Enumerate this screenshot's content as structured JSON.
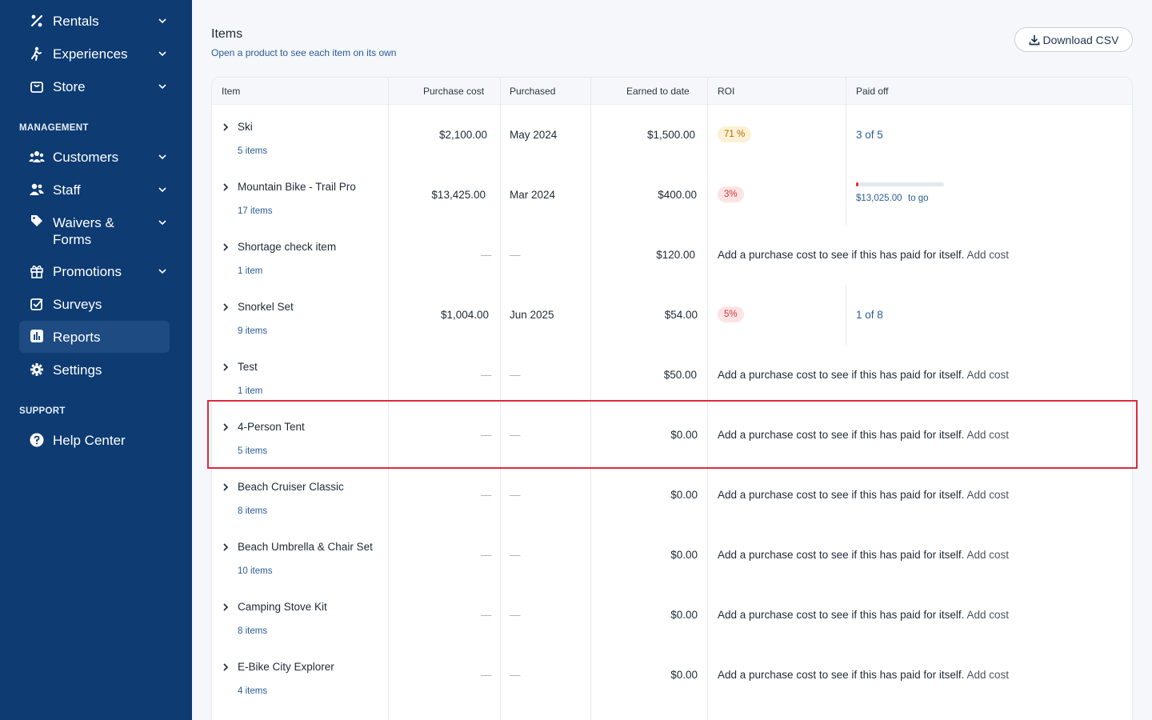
{
  "sidebar": {
    "items": [
      {
        "label": "Rentals",
        "icon": "rentals-icon"
      },
      {
        "label": "Experiences",
        "icon": "experiences-icon"
      },
      {
        "label": "Store",
        "icon": "store-icon"
      },
      {
        "label": "Customers",
        "icon": "customers-icon"
      },
      {
        "label": "Staff",
        "icon": "staff-icon"
      },
      {
        "label": "Waivers &",
        "label2": "Forms",
        "icon": "tag-icon"
      },
      {
        "label": "Promotions",
        "icon": "gift-icon"
      },
      {
        "label": "Surveys",
        "icon": "surveys-icon"
      },
      {
        "label": "Reports",
        "icon": "reports-icon"
      },
      {
        "label": "Settings",
        "icon": "gear-icon"
      },
      {
        "label": "Help Center",
        "icon": "help-icon"
      }
    ],
    "sections": {
      "management": "MANAGEMENT",
      "support": "SUPPORT"
    },
    "active": "Reports"
  },
  "items_section": {
    "title": "Items",
    "subtitle": "Open a product to see each item on its own",
    "download_label": "Download CSV"
  },
  "table": {
    "headers": {
      "item": "Item",
      "purchase_cost": "Purchase cost",
      "purchased": "Purchased",
      "earned": "Earned to date",
      "roi": "ROI",
      "paid_off": "Paid off"
    },
    "dash": "—",
    "add_cost_text": "Add a purchase cost to see if this has paid for itself.",
    "add_cost_link": "Add cost",
    "rows": [
      {
        "name": "Ski",
        "count": "5 items",
        "cost": "$2,100.00",
        "purchased": "May 2024",
        "earned": "$1,500.00",
        "roi": "71 %",
        "roi_level": "warn",
        "paid_off": "3 of 5"
      },
      {
        "name": "Mountain Bike - Trail Pro",
        "count": "17 items",
        "cost": "$13,425.00",
        "purchased": "Mar 2024",
        "earned": "$400.00",
        "roi": "3%",
        "roi_level": "bad",
        "progress_fraction": 0.03,
        "to_go_amount": "$13,025.00",
        "to_go_label": "to go"
      },
      {
        "name": "Shortage check item",
        "count": "1 item",
        "earned": "$120.00"
      },
      {
        "name": "Snorkel Set",
        "count": "9 items",
        "cost": "$1,004.00",
        "purchased": "Jun 2025",
        "earned": "$54.00",
        "roi": "5%",
        "roi_level": "bad",
        "paid_off": "1 of 8"
      },
      {
        "name": "Test",
        "count": "1 item",
        "earned": "$50.00"
      },
      {
        "name": "4-Person Tent",
        "count": "5 items",
        "earned": "$0.00"
      },
      {
        "name": "Beach Cruiser Classic",
        "count": "8 items",
        "earned": "$0.00"
      },
      {
        "name": "Beach Umbrella & Chair Set",
        "count": "10 items",
        "earned": "$0.00"
      },
      {
        "name": "Camping Stove Kit",
        "count": "8 items",
        "earned": "$0.00"
      },
      {
        "name": "E-Bike City Explorer",
        "count": "4 items",
        "earned": "$0.00"
      }
    ]
  }
}
